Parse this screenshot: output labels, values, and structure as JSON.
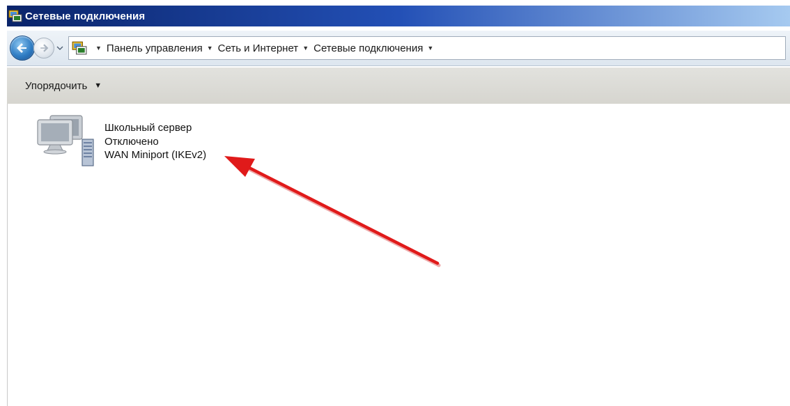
{
  "window": {
    "title": "Сетевые подключения"
  },
  "breadcrumb": [
    {
      "label": "Панель управления"
    },
    {
      "label": "Сеть и Интернет"
    },
    {
      "label": "Сетевые подключения"
    }
  ],
  "toolbar": {
    "organize_label": "Упорядочить"
  },
  "connection": {
    "name": "Школьный сервер",
    "status": "Отключено",
    "device": "WAN Miniport (IKEv2)"
  },
  "annotation": {
    "arrow_color": "#e01a1a"
  },
  "icons": {
    "app": "network-connections-icon",
    "back": "back-arrow-icon",
    "forward": "forward-arrow-icon",
    "connection": "computer-server-icon"
  }
}
